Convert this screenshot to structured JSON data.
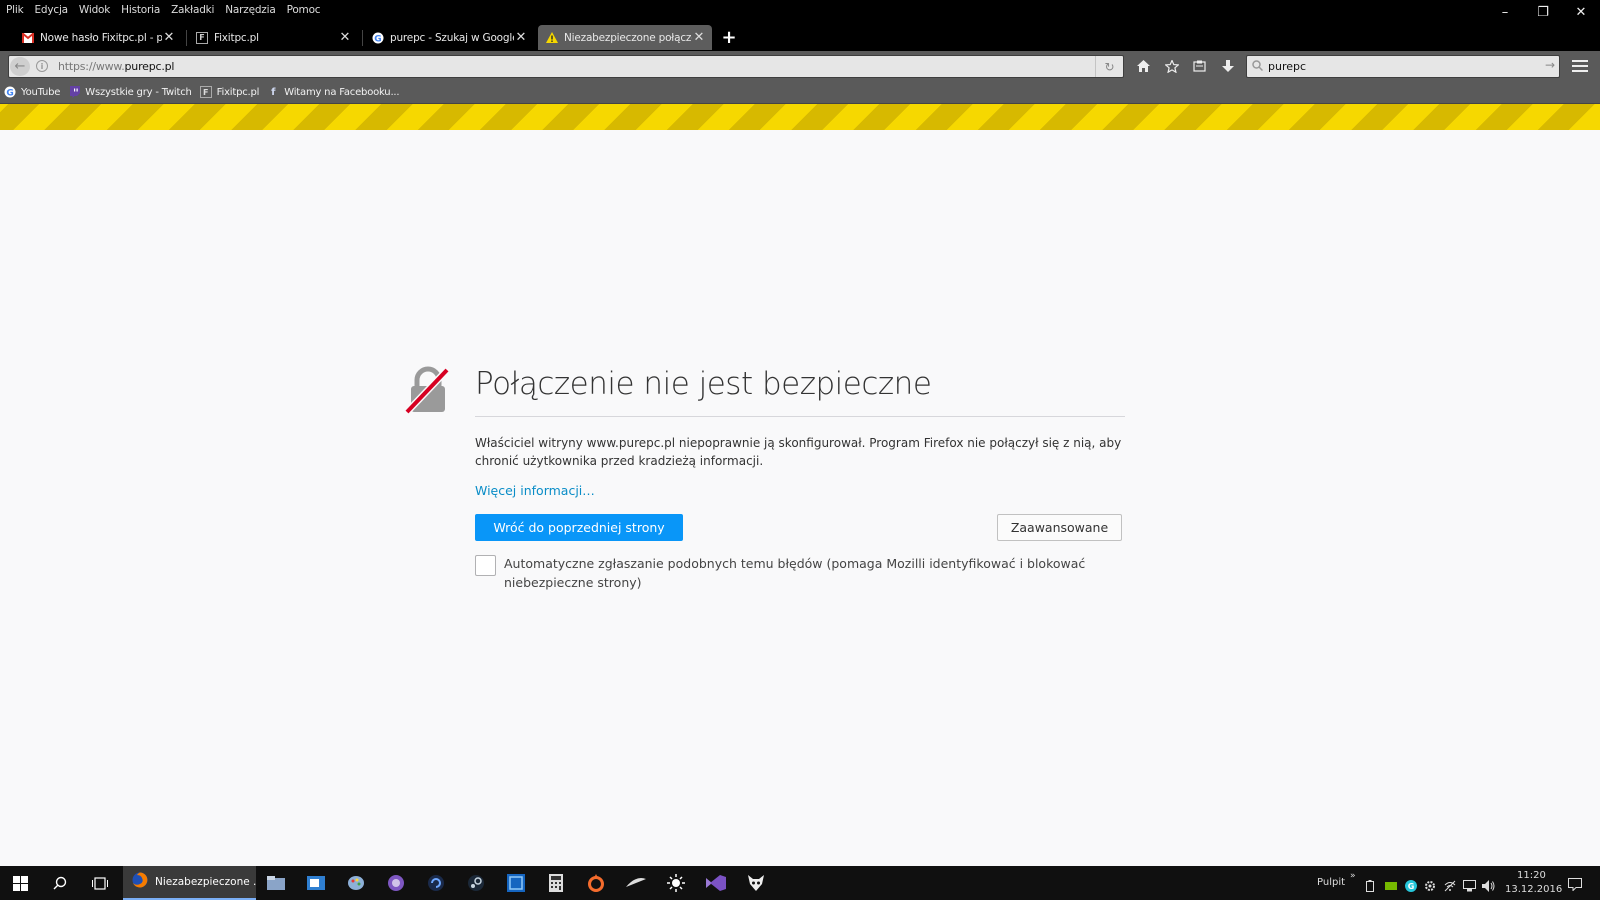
{
  "menubar": {
    "items": [
      "Plik",
      "Edycja",
      "Widok",
      "Historia",
      "Zakładki",
      "Narzędzia",
      "Pomoc"
    ]
  },
  "window_controls": {
    "minimize": "–",
    "restore": "❐",
    "close": "✕"
  },
  "tabs": [
    {
      "title": "Nowe hasło Fixitpc.pl - piz...",
      "icon": "gmail-icon",
      "active": false
    },
    {
      "title": "Fixitpc.pl",
      "icon": "fixitpc-icon",
      "active": false
    },
    {
      "title": "purepc - Szukaj w Google",
      "icon": "google-icon",
      "active": false
    },
    {
      "title": "Niezabezpieczone połącze...",
      "icon": "warning-icon",
      "active": true
    }
  ],
  "navbar": {
    "url_prefix": "https://www.",
    "url_domain": "purepc.pl",
    "search_value": "purepc"
  },
  "bookmarks": [
    {
      "label": "YouTube",
      "icon": "google-icon"
    },
    {
      "label": "Wszystkie gry - Twitch",
      "icon": "twitch-icon"
    },
    {
      "label": "Fixitpc.pl",
      "icon": "fixitpc-icon"
    },
    {
      "label": "Witamy na Facebooku...",
      "icon": "facebook-icon"
    }
  ],
  "error_page": {
    "title": "Połączenie nie jest bezpieczne",
    "description": "Właściciel witryny www.purepc.pl niepoprawnie ją skonfigurował. Program Firefox nie połączył się z nią, aby chronić użytkownika przed kradzieżą informacji.",
    "more_info": "Więcej informacji…",
    "back_button": "Wróć do poprzedniej strony",
    "advanced_button": "Zaawansowane",
    "report_checkbox_label": "Automatyczne zgłaszanie podobnych temu błędów (pomaga Mozilli identyfikować i blokować niebezpieczne strony)",
    "report_checked": false
  },
  "taskbar": {
    "active_app_label": "Niezabezpieczone ...",
    "pulpit": "Pulpit",
    "time": "11:20",
    "date": "13.12.2016"
  },
  "colors": {
    "primary_button": "#0996f8",
    "link": "#0a8dc7",
    "stripe_yellow": "#f6d800"
  }
}
